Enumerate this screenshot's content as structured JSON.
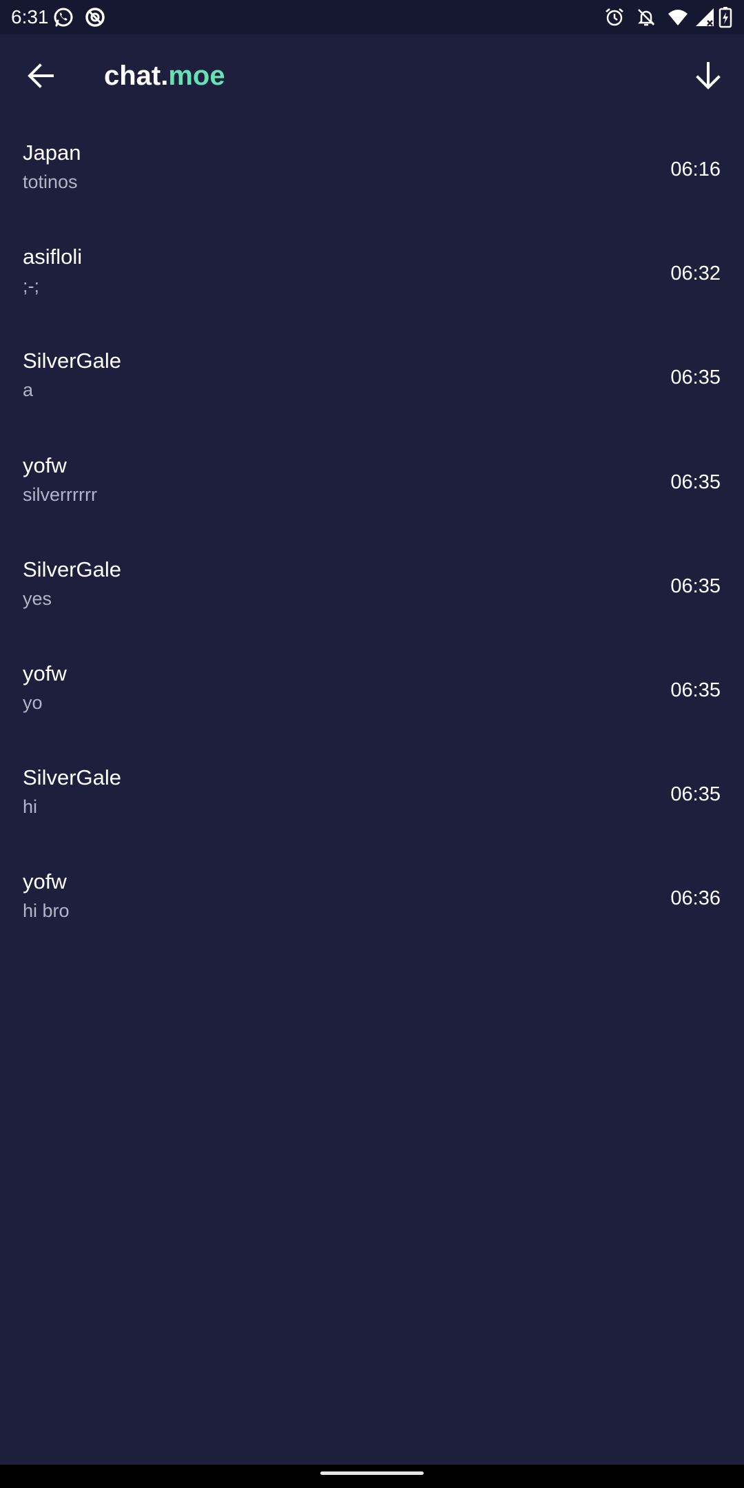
{
  "status_bar": {
    "time": "6:31",
    "icons": [
      "whatsapp-icon",
      "no-disturb-icon",
      "alarm-icon",
      "notifications-off-icon",
      "wifi-icon",
      "signal-icon",
      "battery-charging-icon"
    ]
  },
  "app_bar": {
    "title_prefix": "chat.",
    "title_suffix": "moe",
    "accent_color": "#67e0b3",
    "back_icon": "arrow-left-icon",
    "action_icon": "arrow-down-icon"
  },
  "messages": [
    {
      "author": "Japan",
      "text": "totinos",
      "time": "06:16"
    },
    {
      "author": "asifloli",
      "text": ";-;",
      "time": "06:32"
    },
    {
      "author": "SilverGale",
      "text": "a",
      "time": "06:35"
    },
    {
      "author": "yofw",
      "text": "silverrrrrr",
      "time": "06:35"
    },
    {
      "author": "SilverGale",
      "text": "yes",
      "time": "06:35"
    },
    {
      "author": "yofw",
      "text": "yo",
      "time": "06:35"
    },
    {
      "author": "SilverGale",
      "text": "hi",
      "time": "06:35"
    },
    {
      "author": "yofw",
      "text": "hi bro",
      "time": "06:36"
    }
  ],
  "colors": {
    "background": "#1e1f3d",
    "status_bar": "#161730",
    "primary_text": "#ffffff",
    "secondary_text": "#b3b4c6"
  }
}
